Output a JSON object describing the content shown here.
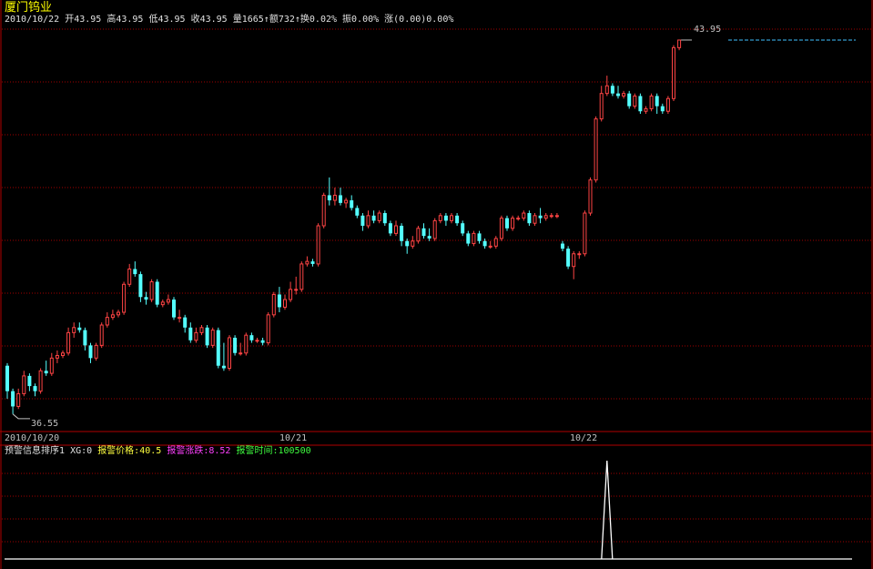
{
  "header": {
    "stock_name": "厦门钨业",
    "info_line": "2010/10/22 开43.95 高43.95 低43.95 收43.95 量1665↑额732↑换0.02% 振0.00% 涨(0.00)0.00%"
  },
  "indicator": {
    "name": "预警信息排序1",
    "xg": "XG:0",
    "price_label": "报警价格:40.5",
    "change_label": "报警涨跌:8.52",
    "time_label": "报警时间:100500"
  },
  "colors": {
    "up": "#ff4444",
    "down": "#54ffff",
    "grid": "#a00000",
    "frame": "#b00000",
    "title": "#ffff00",
    "axis_text": "#c0c0c0",
    "price_label": "#ffff40",
    "change_label": "#ff40ff",
    "time_label": "#40ff40",
    "last_line": "#40c0ff"
  },
  "chart_data": {
    "type": "candlestick",
    "x_tick_labels": [
      "2010/10/20",
      "10/21",
      "10/22"
    ],
    "high_label": "43.95",
    "low_label": "36.55",
    "ylim": [
      36.4,
      44.2
    ],
    "last_close": 43.95,
    "candles": [
      [
        37.55,
        37.05,
        37.6,
        36.9
      ],
      [
        37.05,
        36.75,
        37.1,
        36.6
      ],
      [
        36.75,
        37.0,
        37.1,
        36.7
      ],
      [
        37.0,
        37.35,
        37.45,
        36.95
      ],
      [
        37.35,
        37.15,
        37.4,
        37.05
      ],
      [
        37.15,
        37.05,
        37.2,
        36.95
      ],
      [
        37.05,
        37.45,
        37.5,
        37.0
      ],
      [
        37.45,
        37.4,
        37.65,
        37.35
      ],
      [
        37.4,
        37.7,
        37.8,
        37.35
      ],
      [
        37.7,
        37.75,
        37.85,
        37.6
      ],
      [
        37.75,
        37.8,
        37.85,
        37.7
      ],
      [
        37.8,
        38.2,
        38.3,
        37.75
      ],
      [
        38.2,
        38.3,
        38.4,
        38.1
      ],
      [
        38.3,
        38.25,
        38.4,
        38.2
      ],
      [
        38.25,
        37.95,
        38.3,
        37.85
      ],
      [
        37.95,
        37.7,
        38.0,
        37.6
      ],
      [
        37.7,
        37.95,
        38.0,
        37.65
      ],
      [
        37.95,
        38.35,
        38.4,
        37.9
      ],
      [
        38.35,
        38.5,
        38.6,
        38.3
      ],
      [
        38.5,
        38.55,
        38.65,
        38.45
      ],
      [
        38.55,
        38.6,
        38.65,
        38.5
      ],
      [
        38.6,
        39.15,
        39.2,
        38.55
      ],
      [
        39.15,
        39.45,
        39.55,
        39.1
      ],
      [
        39.45,
        39.35,
        39.6,
        39.3
      ],
      [
        39.35,
        38.9,
        39.4,
        38.8
      ],
      [
        38.9,
        38.85,
        39.0,
        38.75
      ],
      [
        38.85,
        39.2,
        39.25,
        38.8
      ],
      [
        39.2,
        38.75,
        39.25,
        38.7
      ],
      [
        38.75,
        38.8,
        38.85,
        38.7
      ],
      [
        38.8,
        38.85,
        38.95,
        38.75
      ],
      [
        38.85,
        38.5,
        38.9,
        38.45
      ],
      [
        38.5,
        38.5,
        38.65,
        38.4
      ],
      [
        38.5,
        38.3,
        38.55,
        38.2
      ],
      [
        38.3,
        38.05,
        38.4,
        38.0
      ],
      [
        38.05,
        38.2,
        38.3,
        38.0
      ],
      [
        38.2,
        38.3,
        38.35,
        38.15
      ],
      [
        38.3,
        37.95,
        38.35,
        37.9
      ],
      [
        37.95,
        38.25,
        38.3,
        37.9
      ],
      [
        38.25,
        37.55,
        38.3,
        37.5
      ],
      [
        37.55,
        37.5,
        38.0,
        37.45
      ],
      [
        37.5,
        38.1,
        38.15,
        37.45
      ],
      [
        38.1,
        37.8,
        38.15,
        37.75
      ],
      [
        37.8,
        37.8,
        38.0,
        37.75
      ],
      [
        37.8,
        38.15,
        38.2,
        37.75
      ],
      [
        38.15,
        38.05,
        38.2,
        38.0
      ],
      [
        38.05,
        38.05,
        38.1,
        38.0
      ],
      [
        38.05,
        38.0,
        38.1,
        37.95
      ],
      [
        38.0,
        38.55,
        38.6,
        37.95
      ],
      [
        38.55,
        38.95,
        39.0,
        38.5
      ],
      [
        38.95,
        38.7,
        39.1,
        38.6
      ],
      [
        38.7,
        38.85,
        38.95,
        38.65
      ],
      [
        38.85,
        39.05,
        39.2,
        38.8
      ],
      [
        39.05,
        39.05,
        39.3,
        38.95
      ],
      [
        39.05,
        39.55,
        39.6,
        39.0
      ],
      [
        39.55,
        39.6,
        39.7,
        39.5
      ],
      [
        39.6,
        39.55,
        39.65,
        39.5
      ],
      [
        39.55,
        40.3,
        40.35,
        39.5
      ],
      [
        40.3,
        40.9,
        40.95,
        40.25
      ],
      [
        40.9,
        40.8,
        41.25,
        40.7
      ],
      [
        40.8,
        40.9,
        41.05,
        40.7
      ],
      [
        40.9,
        40.75,
        41.05,
        40.7
      ],
      [
        40.75,
        40.8,
        40.85,
        40.65
      ],
      [
        40.8,
        40.65,
        40.9,
        40.6
      ],
      [
        40.65,
        40.5,
        40.7,
        40.45
      ],
      [
        40.5,
        40.3,
        40.55,
        40.2
      ],
      [
        40.3,
        40.5,
        40.6,
        40.25
      ],
      [
        40.5,
        40.4,
        40.6,
        40.35
      ],
      [
        40.4,
        40.55,
        40.6,
        40.35
      ],
      [
        40.55,
        40.35,
        40.6,
        40.3
      ],
      [
        40.35,
        40.15,
        40.4,
        40.1
      ],
      [
        40.15,
        40.3,
        40.4,
        40.1
      ],
      [
        40.3,
        40.0,
        40.35,
        39.9
      ],
      [
        40.0,
        39.9,
        40.05,
        39.75
      ],
      [
        39.9,
        40.0,
        40.1,
        39.85
      ],
      [
        40.0,
        40.25,
        40.3,
        39.95
      ],
      [
        40.25,
        40.1,
        40.35,
        40.05
      ],
      [
        40.1,
        40.05,
        40.25,
        40.0
      ],
      [
        40.05,
        40.4,
        40.45,
        40.0
      ],
      [
        40.4,
        40.5,
        40.55,
        40.35
      ],
      [
        40.5,
        40.4,
        40.55,
        40.3
      ],
      [
        40.4,
        40.5,
        40.55,
        40.35
      ],
      [
        40.5,
        40.35,
        40.55,
        40.3
      ],
      [
        40.35,
        40.15,
        40.4,
        40.1
      ],
      [
        40.15,
        39.95,
        40.2,
        39.9
      ],
      [
        39.95,
        40.15,
        40.2,
        39.9
      ],
      [
        40.15,
        40.0,
        40.2,
        39.95
      ],
      [
        40.0,
        39.9,
        40.05,
        39.85
      ],
      [
        39.9,
        39.9,
        40.0,
        39.85
      ],
      [
        39.9,
        40.05,
        40.1,
        39.85
      ],
      [
        40.05,
        40.45,
        40.5,
        40.0
      ],
      [
        40.45,
        40.25,
        40.5,
        40.2
      ],
      [
        40.25,
        40.45,
        40.5,
        40.2
      ],
      [
        40.45,
        40.45,
        40.5,
        40.4
      ],
      [
        40.45,
        40.55,
        40.6,
        40.4
      ],
      [
        40.55,
        40.35,
        40.6,
        40.3
      ],
      [
        40.35,
        40.5,
        40.55,
        40.3
      ],
      [
        40.5,
        40.45,
        40.65,
        40.35
      ],
      [
        40.45,
        40.5,
        40.55,
        40.4
      ],
      [
        40.5,
        40.5,
        40.55,
        40.45
      ],
      [
        40.5,
        40.5,
        40.55,
        40.45
      ],
      [
        39.95,
        39.85,
        40.0,
        39.8
      ],
      [
        39.85,
        39.5,
        39.9,
        39.45
      ],
      [
        39.5,
        39.75,
        39.8,
        39.25
      ],
      [
        39.75,
        39.75,
        39.8,
        39.65
      ],
      [
        39.75,
        40.55,
        40.6,
        39.7
      ],
      [
        40.55,
        41.2,
        41.25,
        40.5
      ],
      [
        41.2,
        42.4,
        42.45,
        41.15
      ],
      [
        42.4,
        42.9,
        43.05,
        42.35
      ],
      [
        42.9,
        43.05,
        43.25,
        42.85
      ],
      [
        43.05,
        42.9,
        43.1,
        42.85
      ],
      [
        42.9,
        42.85,
        43.05,
        42.8
      ],
      [
        42.85,
        42.9,
        42.95,
        42.8
      ],
      [
        42.9,
        42.65,
        42.95,
        42.6
      ],
      [
        42.65,
        42.85,
        42.9,
        42.6
      ],
      [
        42.85,
        42.55,
        42.9,
        42.5
      ],
      [
        42.55,
        42.6,
        42.65,
        42.5
      ],
      [
        42.6,
        42.85,
        42.9,
        42.55
      ],
      [
        42.85,
        42.65,
        42.9,
        42.5
      ],
      [
        42.65,
        42.55,
        42.7,
        42.5
      ],
      [
        42.55,
        42.8,
        42.85,
        42.5
      ],
      [
        42.8,
        43.8,
        43.85,
        42.75
      ],
      [
        43.8,
        43.95,
        43.95,
        43.75
      ]
    ],
    "indicator_series": {
      "peak_index": 108,
      "peak_value": 1
    }
  }
}
